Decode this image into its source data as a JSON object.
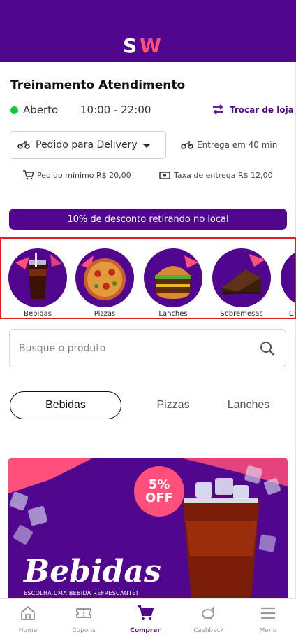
{
  "header": {
    "logo_text": "SW",
    "colors": {
      "brand": "#51068f",
      "accent": "#ff4f7b"
    }
  },
  "store": {
    "name": "Treinamento Atendimento",
    "status": "Aberto",
    "hours": "10:00 - 22:00",
    "switch_store": "Trocar de loja",
    "status_color": "#19c93a"
  },
  "order": {
    "mode_selected": "Pedido para Delivery",
    "eta": "Entrega em 40 min",
    "min_order": "Pedido mínimo R$ 20,00",
    "delivery_fee": "Taxa de entrega R$ 12,00"
  },
  "promo_banner": "10% de desconto retirando no local",
  "categories": [
    {
      "name": "Bebidas",
      "icon": "soda-glass-icon"
    },
    {
      "name": "Pizzas",
      "icon": "pizza-icon"
    },
    {
      "name": "Lanches",
      "icon": "burger-icon"
    },
    {
      "name": "Sobremesas",
      "icon": "cake-icon"
    },
    {
      "name": "C",
      "icon": "category-icon"
    }
  ],
  "search": {
    "placeholder": "Busque o produto",
    "icon": "search-icon"
  },
  "tabs": [
    "Bebidas",
    "Pizzas",
    "Lanches"
  ],
  "active_tab": "Bebidas",
  "product_banner": {
    "badge_pct": "5%",
    "badge_off": "OFF",
    "title": "Bebidas",
    "subtitle": "ESCOLHA UMA BEBIDA REFRESCANTE!"
  },
  "bottom_nav": [
    {
      "label": "Home",
      "icon": "home-icon"
    },
    {
      "label": "Cupons",
      "icon": "ticket-icon"
    },
    {
      "label": "Comprar",
      "icon": "cart-icon"
    },
    {
      "label": "Cashback",
      "icon": "piggy-bank-icon"
    },
    {
      "label": "Menu",
      "icon": "menu-icon"
    }
  ],
  "bottom_nav_active": "Comprar"
}
